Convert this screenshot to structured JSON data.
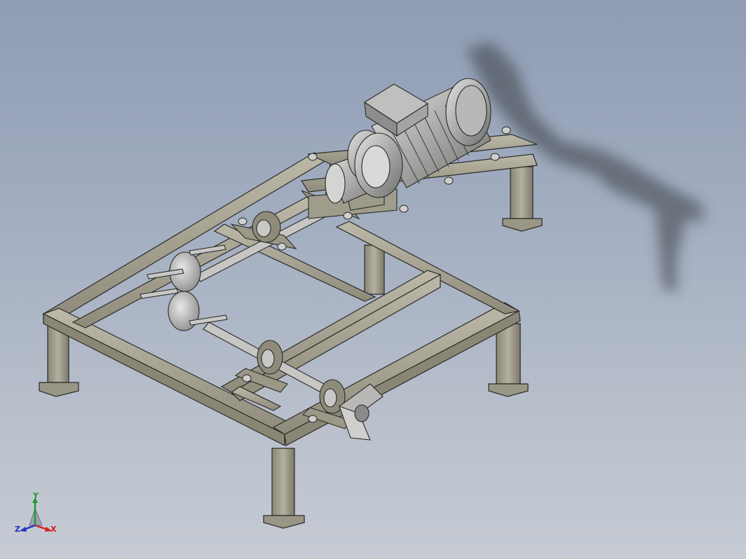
{
  "viewport": {
    "background_top": "#8f9cb3",
    "background_bottom": "#c6cbd4"
  },
  "triad": {
    "x_label": "X",
    "y_label": "Y",
    "z_label": "Z",
    "x_color": "#d42020",
    "y_color": "#1e9a2a",
    "z_color": "#2030c8"
  },
  "model": {
    "steel_color": "#a8a494",
    "metal_color": "#c7c8c6",
    "dark_color": "#2a2a28"
  }
}
